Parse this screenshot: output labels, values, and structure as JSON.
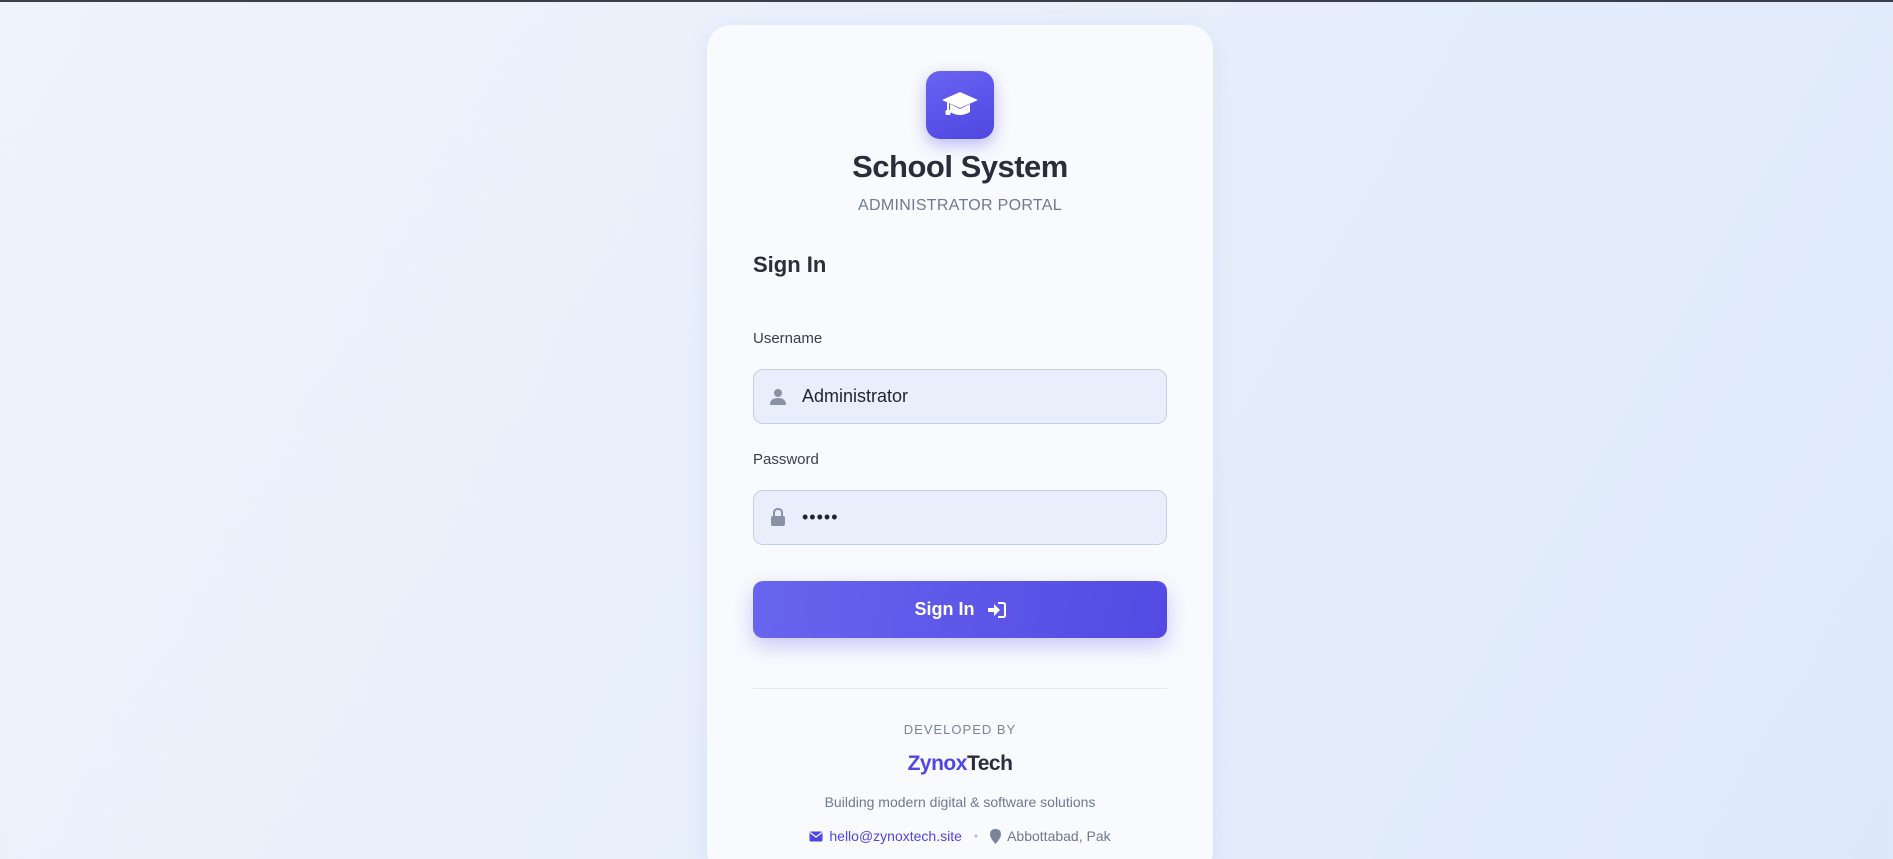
{
  "app": {
    "title": "School System",
    "subtitle": "ADMINISTRATOR PORTAL",
    "logo_icon": "graduation-cap-icon"
  },
  "form": {
    "heading": "Sign In",
    "username": {
      "label": "Username",
      "value": "Administrator",
      "icon": "user-icon"
    },
    "password": {
      "label": "Password",
      "masked_value": "•••••",
      "icon": "lock-icon"
    },
    "submit": {
      "label": "Sign In",
      "icon": "sign-in-arrow-icon"
    }
  },
  "footer": {
    "developed_by": "DEVELOPED BY",
    "brand_part1": "Zynox",
    "brand_part2": "Tech",
    "tagline": "Building modern digital & software solutions",
    "email": "hello@zynoxtech.site",
    "location": "Abbottabad, Pak",
    "separator": "•"
  },
  "colors": {
    "accent": "#4f46e5",
    "text_dark": "#2a2e3a",
    "text_muted": "#6e7a90"
  }
}
